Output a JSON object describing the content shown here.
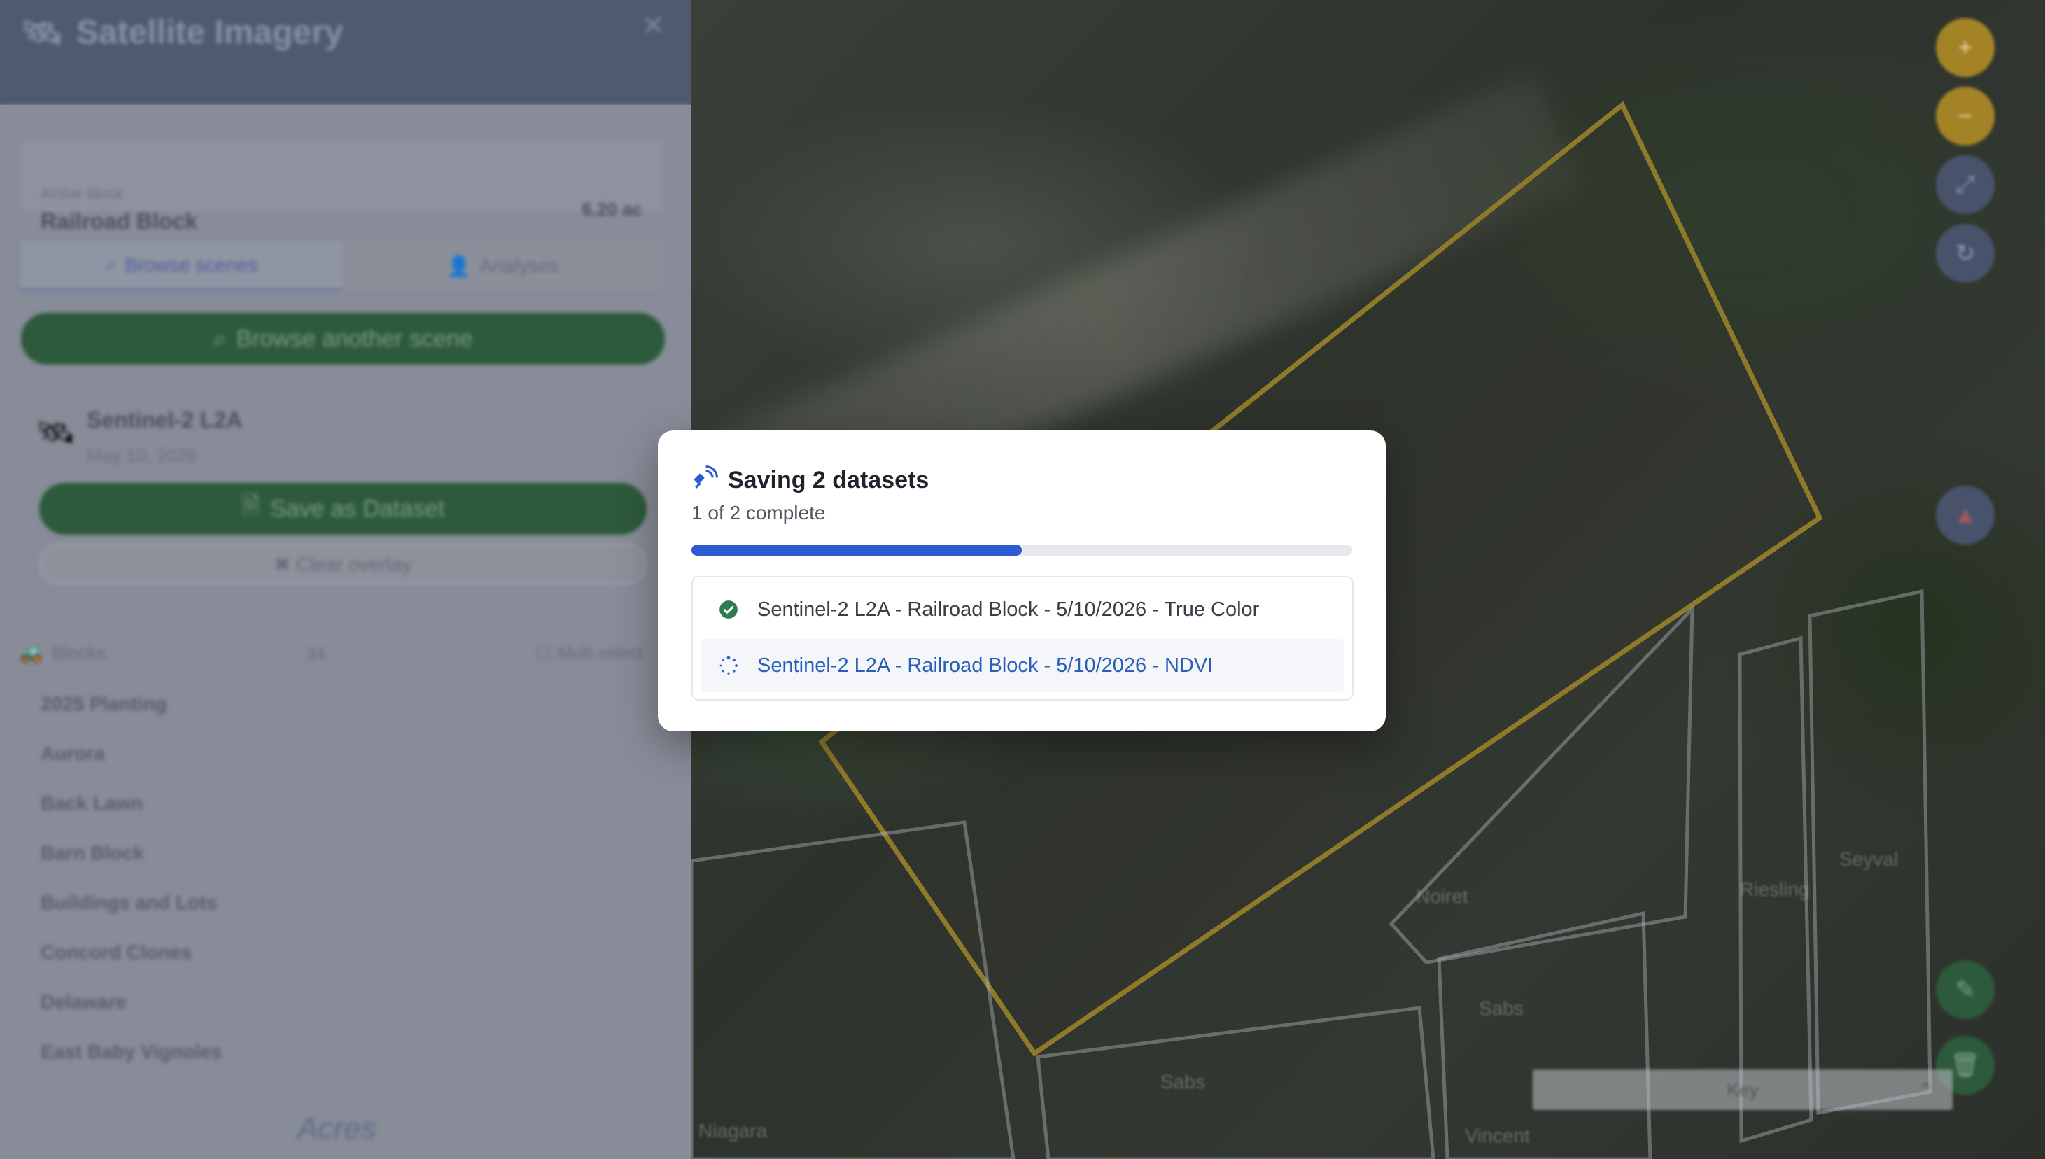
{
  "sidebar": {
    "title": "Satellite Imagery",
    "close_icon": "close-icon",
    "active_block_label": "Active block",
    "active_block_name": "Railroad Block",
    "active_block_area": "6.20 ac",
    "tabs": [
      {
        "label": "Browse scenes",
        "icon": "search-icon",
        "active": true
      },
      {
        "label": "Analyses",
        "icon": "person-icon",
        "active": false
      }
    ],
    "browse_button_label": "Browse another scene",
    "scene": {
      "name": "Sentinel-2 L2A",
      "date": "May 10, 2026",
      "save_button_label": "Save as Dataset",
      "clear_button_label": "✖ Clear overlay"
    },
    "blocks_header": {
      "label": "Blocks",
      "count": "34",
      "multi_select_label": "Multi-select"
    },
    "blocks": [
      "2025 Planting",
      "Aurora",
      "Back Lawn",
      "Barn Block",
      "Buildings and Lots",
      "Concord Clones",
      "Delaware",
      "East Baby Vignoles"
    ],
    "footer_logo": "Acres"
  },
  "map": {
    "labels": [
      "Noiret",
      "Riesling",
      "Seyval",
      "Sabs",
      "Sabs",
      "Vincent",
      "Niagara"
    ],
    "key_label": "Key",
    "controls": [
      "zoom-in",
      "zoom-out",
      "fullscreen",
      "refresh",
      "compass",
      "edit",
      "delete"
    ]
  },
  "modal": {
    "title": "Saving 2 datasets",
    "progress_text": "1 of 2 complete",
    "progress": 0.5,
    "items": [
      {
        "label": "Sentinel-2 L2A - Railroad Block - 5/10/2026 - True Color",
        "status": "done"
      },
      {
        "label": "Sentinel-2 L2A - Railroad Block - 5/10/2026 - NDVI",
        "status": "in-progress"
      }
    ]
  },
  "colors": {
    "accent_blue": "#2d5bd1",
    "success_green": "#2e7d4f",
    "block_outline": "#a88a2c"
  }
}
